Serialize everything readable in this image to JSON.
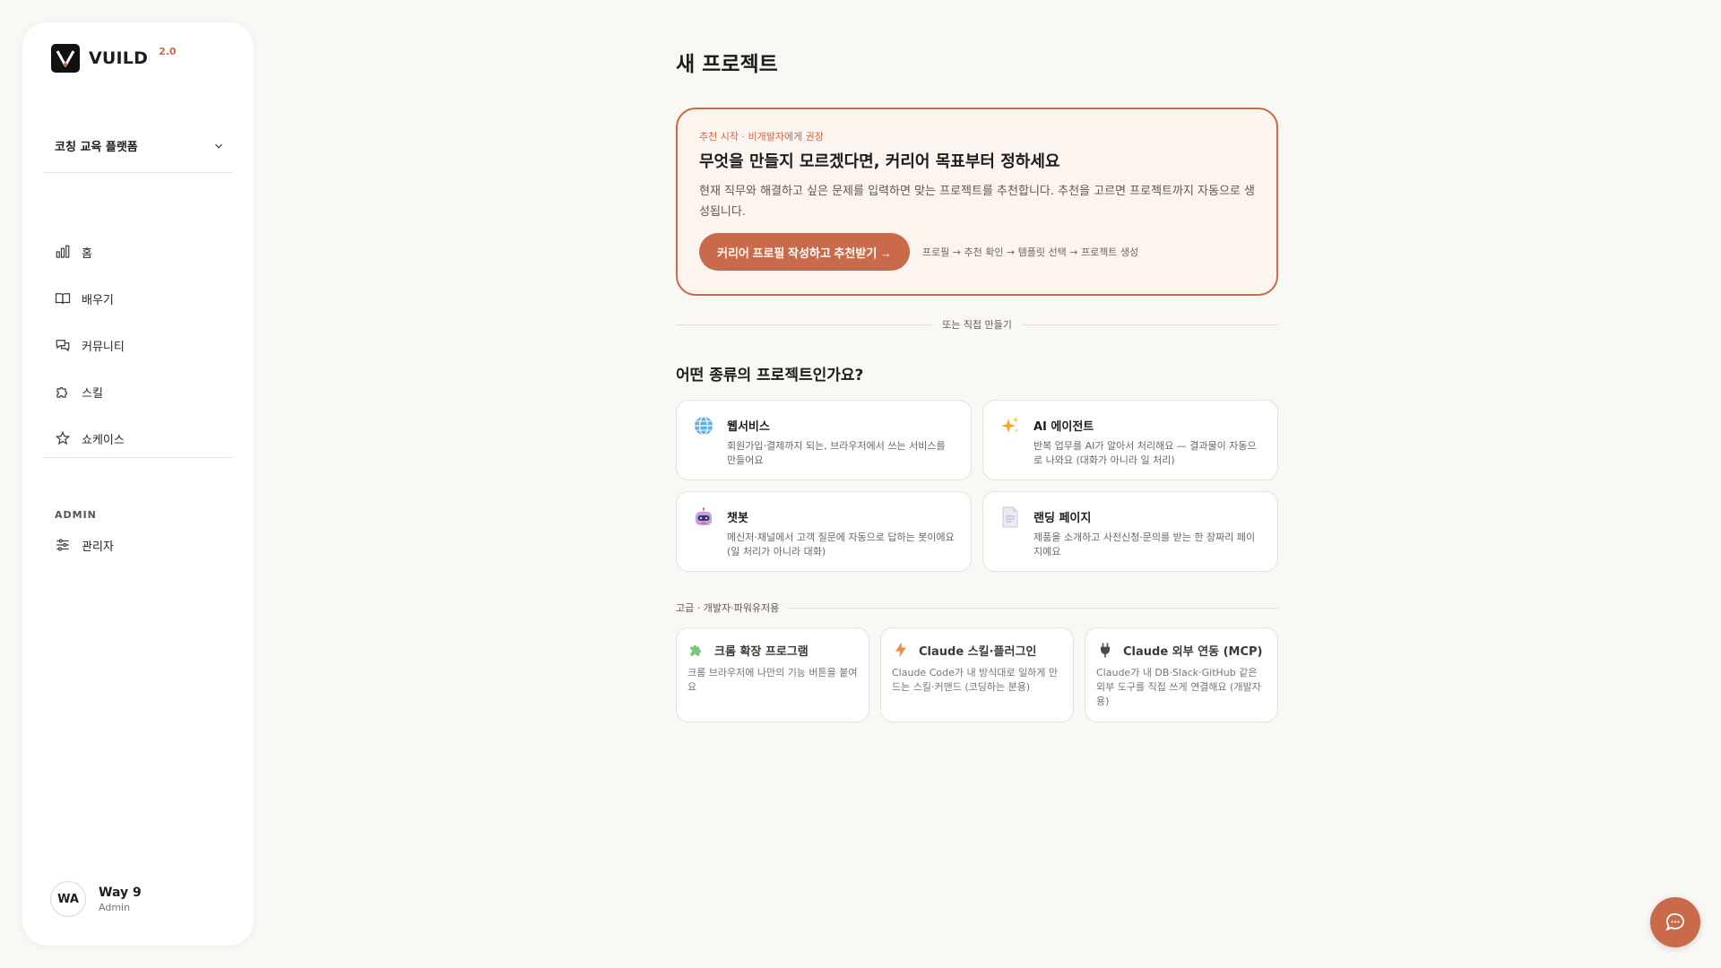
{
  "brand": {
    "name": "VUILD",
    "version": "2.0",
    "accent": "#c96a4a"
  },
  "workspace": {
    "selected": "코칭 교육 플랫폼"
  },
  "nav": [
    {
      "label": "홈",
      "icon": "bar-chart-icon"
    },
    {
      "label": "배우기",
      "icon": "book-icon"
    },
    {
      "label": "커뮤니티",
      "icon": "chat-bubbles-icon"
    },
    {
      "label": "스킬",
      "icon": "puzzle-icon"
    },
    {
      "label": "쇼케이스",
      "icon": "star-icon"
    }
  ],
  "admin": {
    "section_label": "ADMIN",
    "item_label": "관리자"
  },
  "user": {
    "initials": "WA",
    "name": "Way 9",
    "role": "Admin"
  },
  "main": {
    "title": "새 프로젝트",
    "hero": {
      "kicker": "추천 시작 · 비개발자에게 권장",
      "title": "무엇을 만들지 모르겠다면, 커리어 목표부터 정하세요",
      "desc": "현재 직무와 해결하고 싶은 문제를 입력하면 맞는 프로젝트를 추천합니다. 추천을 고르면 프로젝트까지 자동으로 생성됩니다.",
      "button": "커리어 프로필 작성하고 추천받기 →",
      "steps": "프로필 → 추천 확인 → 템플릿 선택 → 프로젝트 생성"
    },
    "or_label": "또는 직접 만들기",
    "question": "어떤 종류의 프로젝트인가요?",
    "types": [
      {
        "title": "웹서비스",
        "desc": "회원가입·결제까지 되는, 브라우저에서 쓰는 서비스를 만들어요",
        "icon": "globe-icon"
      },
      {
        "title": "AI 에이전트",
        "desc": "반복 업무를 AI가 알아서 처리해요 — 결과물이 자동으로 나와요 (대화가 아니라 일 처리)",
        "icon": "sparkles-icon"
      },
      {
        "title": "챗봇",
        "desc": "메신저·채널에서 고객 질문에 자동으로 답하는 봇이에요 (일 처리가 아니라 대화)",
        "icon": "robot-icon"
      },
      {
        "title": "랜딩 페이지",
        "desc": "제품을 소개하고 사전신청·문의를 받는 한 장짜리 페이지예요",
        "icon": "document-icon"
      }
    ],
    "advanced_label": "고급 · 개발자·파워유저용",
    "advanced": [
      {
        "title": "크롬 확장 프로그램",
        "desc": "크롬 브라우저에 나만의 기능 버튼을 붙여요",
        "icon": "puzzle-piece-icon"
      },
      {
        "title": "Claude 스킬·플러그인",
        "desc": "Claude Code가 내 방식대로 일하게 만드는 스킬·커맨드 (코딩하는 분용)",
        "icon": "lightning-icon"
      },
      {
        "title": "Claude 외부 연동 (MCP)",
        "desc": "Claude가 내 DB·Slack·GitHub 같은 외부 도구를 직접 쓰게 연결해요 (개발자용)",
        "icon": "plug-icon"
      }
    ]
  },
  "chat_fab": {
    "icon": "chat-icon"
  }
}
